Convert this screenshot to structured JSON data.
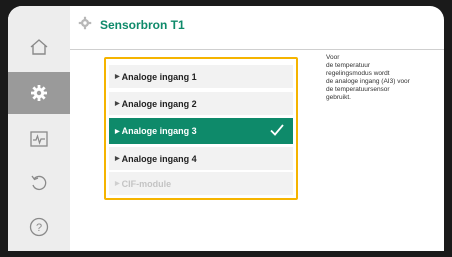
{
  "header": {
    "title": "Sensorbron T1"
  },
  "sidebar": {
    "items": [
      {
        "icon": "home-icon"
      },
      {
        "icon": "gear-icon",
        "active": true
      },
      {
        "icon": "diagnostics-icon"
      },
      {
        "icon": "undo-icon"
      },
      {
        "icon": "help-icon"
      }
    ]
  },
  "menu": {
    "items": [
      {
        "label": "Analoge ingang 1",
        "state": "normal"
      },
      {
        "label": "Analoge ingang 2",
        "state": "normal"
      },
      {
        "label": "Analoge ingang 3",
        "state": "selected"
      },
      {
        "label": "Analoge ingang 4",
        "state": "normal"
      },
      {
        "label": "CIF-module",
        "state": "disabled"
      }
    ]
  },
  "help": {
    "lines": [
      "Voor",
      "de temperatuur",
      "regelingsmodus wordt",
      "de analoge ingang (AI3) voor",
      "de temperatuursensor",
      "gebruikt."
    ]
  },
  "colors": {
    "accent": "#0e8a6a",
    "focus": "#f5b400",
    "sidebar_active": "#9a9a9a"
  }
}
